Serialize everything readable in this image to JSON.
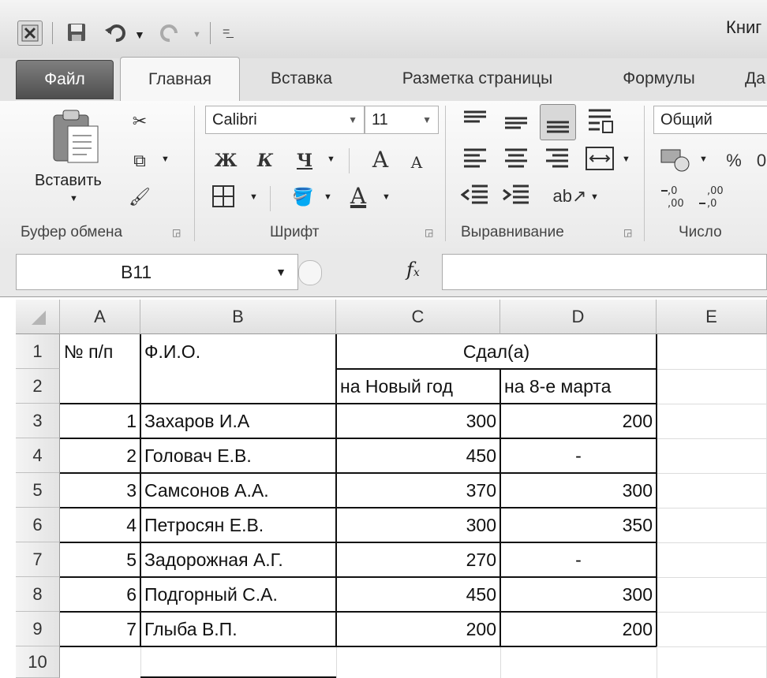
{
  "window": {
    "title": "Книг"
  },
  "quick_access": {
    "icons": [
      "excel-icon",
      "save-icon",
      "undo-icon",
      "redo-icon",
      "customize-icon"
    ]
  },
  "tabs": [
    "Файл",
    "Главная",
    "Вставка",
    "Разметка страницы",
    "Формулы",
    "Да"
  ],
  "ribbon": {
    "clipboard": {
      "paste_label": "Вставить",
      "group_label": "Буфер обмена"
    },
    "font": {
      "font_name": "Calibri",
      "font_size": "11",
      "bold": "Ж",
      "italic": "К",
      "underline": "Ч",
      "grow": "A",
      "shrink": "A",
      "font_color_letter": "A",
      "group_label": "Шрифт"
    },
    "alignment": {
      "group_label": "Выравнивание"
    },
    "number": {
      "format": "Общий",
      "percent": "%",
      "group_label": "Число"
    }
  },
  "formula_bar": {
    "name_box": "B11",
    "fx": "fx",
    "formula": ""
  },
  "sheet": {
    "columns": [
      "A",
      "B",
      "C",
      "D",
      "E"
    ],
    "row_numbers": [
      "1",
      "2",
      "3",
      "4",
      "5",
      "6",
      "7",
      "8",
      "9",
      "10"
    ],
    "header_row1": {
      "a": "№ п/п",
      "b": "Ф.И.О.",
      "cd": "Сдал(а)"
    },
    "header_row2": {
      "c": "на Новый год",
      "d": "на 8-е марта"
    },
    "rows": [
      {
        "n": "1",
        "name": "Захаров И.А",
        "c": "300",
        "d": "200"
      },
      {
        "n": "2",
        "name": "Головач Е.В.",
        "c": "450",
        "d": "-"
      },
      {
        "n": "3",
        "name": "Самсонов А.А.",
        "c": "370",
        "d": "300"
      },
      {
        "n": "4",
        "name": "Петросян Е.В.",
        "c": "300",
        "d": "350"
      },
      {
        "n": "5",
        "name": "Задорожная А.Г.",
        "c": "270",
        "d": "-"
      },
      {
        "n": "6",
        "name": "Подгорный С.А.",
        "c": "450",
        "d": "300"
      },
      {
        "n": "7",
        "name": "Глыба В.П.",
        "c": "200",
        "d": "200"
      }
    ]
  }
}
